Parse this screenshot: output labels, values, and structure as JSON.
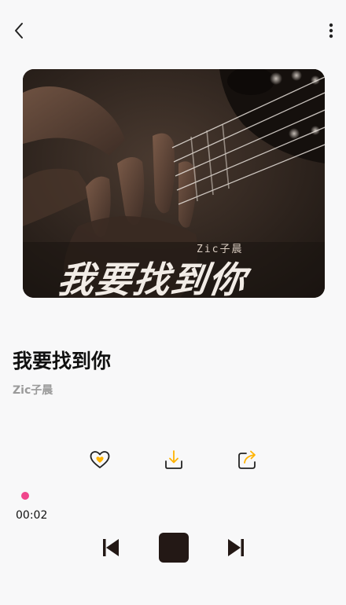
{
  "header": {
    "back_icon": "chevron-left-icon",
    "more_icon": "more-vertical-icon"
  },
  "album": {
    "cover_artist_text": "Zic子晨",
    "cover_title_text": "我要找到你"
  },
  "song": {
    "title": "我要找到你",
    "artist": "Zic子晨"
  },
  "actions": {
    "like_icon": "heart-icon",
    "download_icon": "download-icon",
    "share_icon": "share-icon"
  },
  "player": {
    "elapsed": "00:02",
    "progress_fraction": 0.01,
    "prev_icon": "skip-previous-icon",
    "stop_icon": "stop-icon",
    "next_icon": "skip-next-icon"
  },
  "colors": {
    "accent": "#ffb300",
    "progress": "#f0468c",
    "dark": "#231815"
  }
}
